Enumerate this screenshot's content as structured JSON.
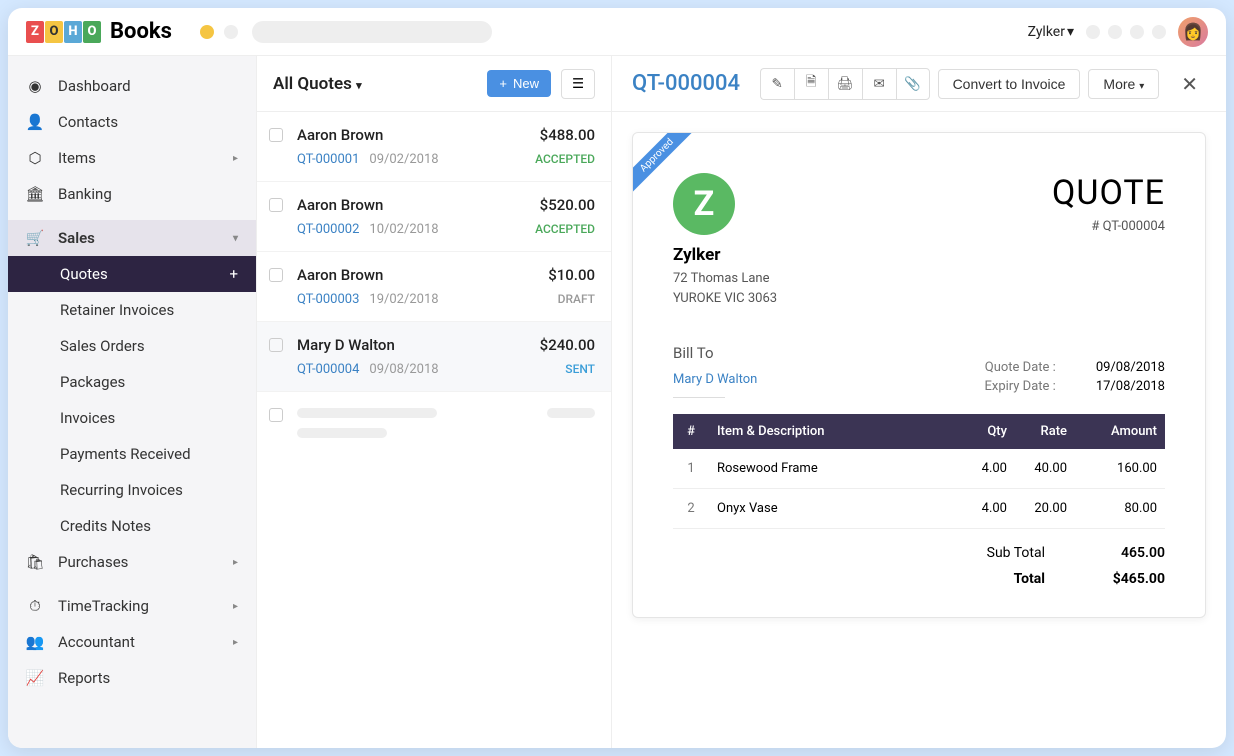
{
  "app": {
    "name_word1": "ZOHO",
    "name_word2": "Books"
  },
  "org": {
    "name": "Zylker"
  },
  "sidebar": {
    "items": [
      {
        "label": "Dashboard"
      },
      {
        "label": "Contacts"
      },
      {
        "label": "Items"
      },
      {
        "label": "Banking"
      },
      {
        "label": "Sales"
      },
      {
        "label": "Purchases"
      },
      {
        "label": "TimeTracking"
      },
      {
        "label": "Accountant"
      },
      {
        "label": "Reports"
      }
    ],
    "sales_sub": [
      {
        "label": "Quotes"
      },
      {
        "label": "Retainer Invoices"
      },
      {
        "label": "Sales Orders"
      },
      {
        "label": "Packages"
      },
      {
        "label": "Invoices"
      },
      {
        "label": "Payments Received"
      },
      {
        "label": "Recurring Invoices"
      },
      {
        "label": "Credits Notes"
      }
    ]
  },
  "list": {
    "title": "All Quotes",
    "new_label": "New",
    "quotes": [
      {
        "name": "Aaron Brown",
        "amount": "$488.00",
        "id": "QT-000001",
        "date": "09/02/2018",
        "status": "ACCEPTED"
      },
      {
        "name": "Aaron Brown",
        "amount": "$520.00",
        "id": "QT-000002",
        "date": "10/02/2018",
        "status": "ACCEPTED"
      },
      {
        "name": "Aaron Brown",
        "amount": "$10.00",
        "id": "QT-000003",
        "date": "19/02/2018",
        "status": "DRAFT"
      },
      {
        "name": "Mary D Walton",
        "amount": "$240.00",
        "id": "QT-000004",
        "date": "09/08/2018",
        "status": "SENT"
      }
    ]
  },
  "detail": {
    "title": "QT-000004",
    "convert_label": "Convert to Invoice",
    "more_label": "More",
    "ribbon": "Approved",
    "company": {
      "name": "Zylker",
      "addr1": "72 Thomas Lane",
      "addr2": "YUROKE VIC 3063"
    },
    "heading": "QUOTE",
    "number_prefix": "# QT-000004",
    "bill_to_label": "Bill To",
    "bill_to_name": "Mary D Walton",
    "dates": {
      "quote_date_label": "Quote Date :",
      "quote_date": "09/08/2018",
      "expiry_date_label": "Expiry Date :",
      "expiry_date": "17/08/2018"
    },
    "columns": {
      "idx": "#",
      "item": "Item & Description",
      "qty": "Qty",
      "rate": "Rate",
      "amount": "Amount"
    },
    "items": [
      {
        "idx": "1",
        "name": "Rosewood Frame",
        "qty": "4.00",
        "rate": "40.00",
        "amount": "160.00"
      },
      {
        "idx": "2",
        "name": "Onyx Vase",
        "qty": "4.00",
        "rate": "20.00",
        "amount": "80.00"
      }
    ],
    "subtotal_label": "Sub Total",
    "subtotal": "465.00",
    "total_label": "Total",
    "total": "$465.00"
  }
}
